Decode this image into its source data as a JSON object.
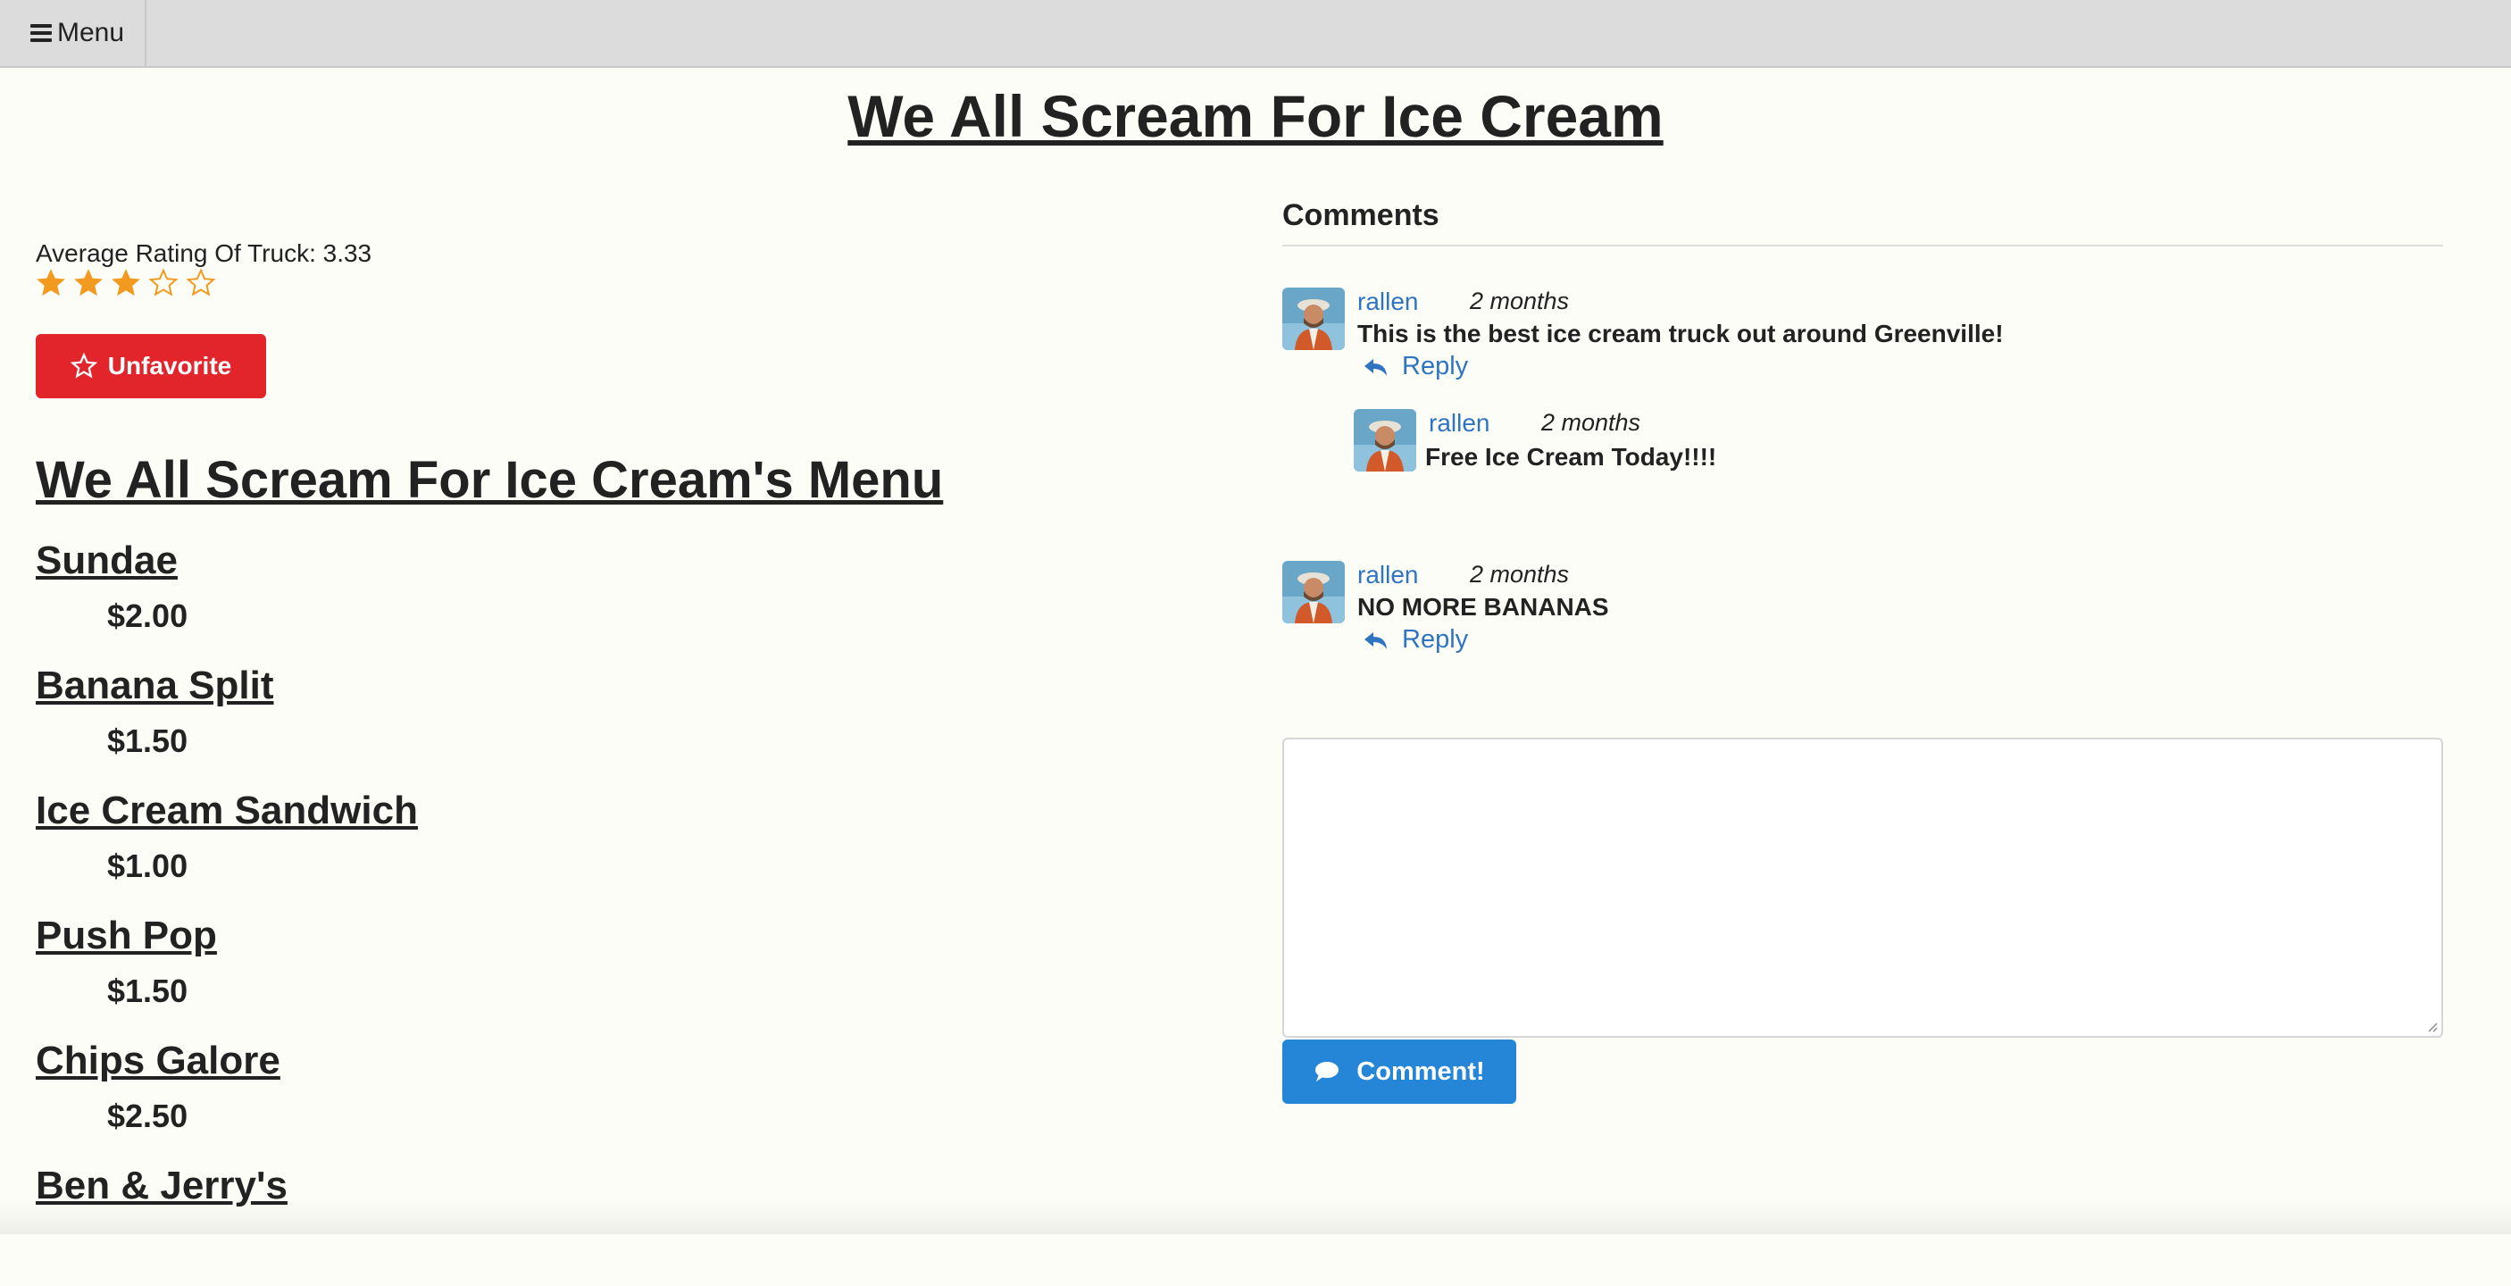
{
  "topbar": {
    "menu_label": "Menu",
    "menu_icon": "hamburger-icon"
  },
  "page": {
    "title": "We All Scream For Ice Cream"
  },
  "rating": {
    "label": "Average Rating Of Truck: 3.33",
    "value": 3.33,
    "max": 5,
    "filled_stars": 3
  },
  "favorite": {
    "button_label": "Unfavorite",
    "icon": "star-outline-icon",
    "color": "#e2242b"
  },
  "menu": {
    "title": "We All Scream For Ice Cream's Menu",
    "items": [
      {
        "name": "Sundae",
        "price": "$2.00"
      },
      {
        "name": "Banana Split",
        "price": "$1.50"
      },
      {
        "name": "Ice Cream Sandwich",
        "price": "$1.00"
      },
      {
        "name": "Push Pop",
        "price": "$1.50"
      },
      {
        "name": "Chips Galore",
        "price": "$2.50"
      },
      {
        "name": "Ben & Jerry's",
        "price": ""
      }
    ]
  },
  "comments": {
    "heading": "Comments",
    "list": [
      {
        "author": "rallen",
        "time": "2 months",
        "text": "This is the best ice cream truck out around Greenville!",
        "reply_label": "Reply"
      },
      {
        "author": "rallen",
        "time": "2 months",
        "text": "Free Ice Cream Today!!!!",
        "reply_label": ""
      },
      {
        "author": "rallen",
        "time": "2 months",
        "text": "NO MORE BANANAS",
        "reply_label": "Reply"
      }
    ],
    "input_placeholder": "",
    "submit_label": "Comment!",
    "link_color": "#2f74c0",
    "submit_color": "#2586d8"
  }
}
